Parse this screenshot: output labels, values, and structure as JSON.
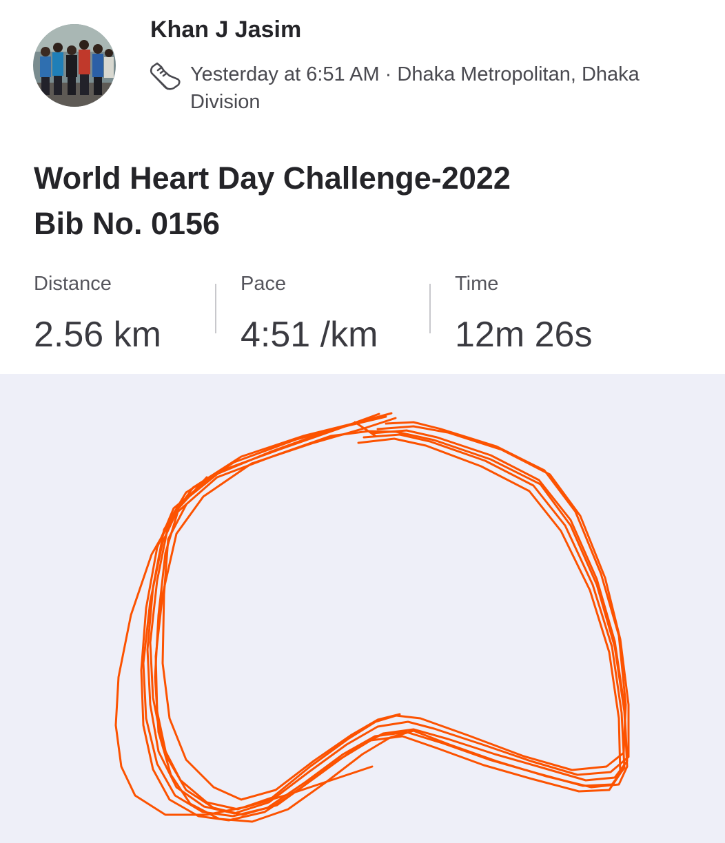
{
  "header": {
    "athlete_name": "Khan J Jasim",
    "activity_type_icon": "running-shoe-icon",
    "meta": "Yesterday at 6:51 AM · Dhaka Metropolitan, Dhaka Division"
  },
  "activity": {
    "title": "World Heart Day Challenge-2022\nBib No. 0156"
  },
  "stats": {
    "distance": {
      "label": "Distance",
      "value": "2.56 km"
    },
    "pace": {
      "label": "Pace",
      "value": "4:51 /km"
    },
    "time": {
      "label": "Time",
      "value": "12m 26s"
    }
  },
  "colors": {
    "route": "#fc5200",
    "map_background": "#eeeff8",
    "text_primary": "#242428",
    "text_secondary": "#4a4a50"
  }
}
